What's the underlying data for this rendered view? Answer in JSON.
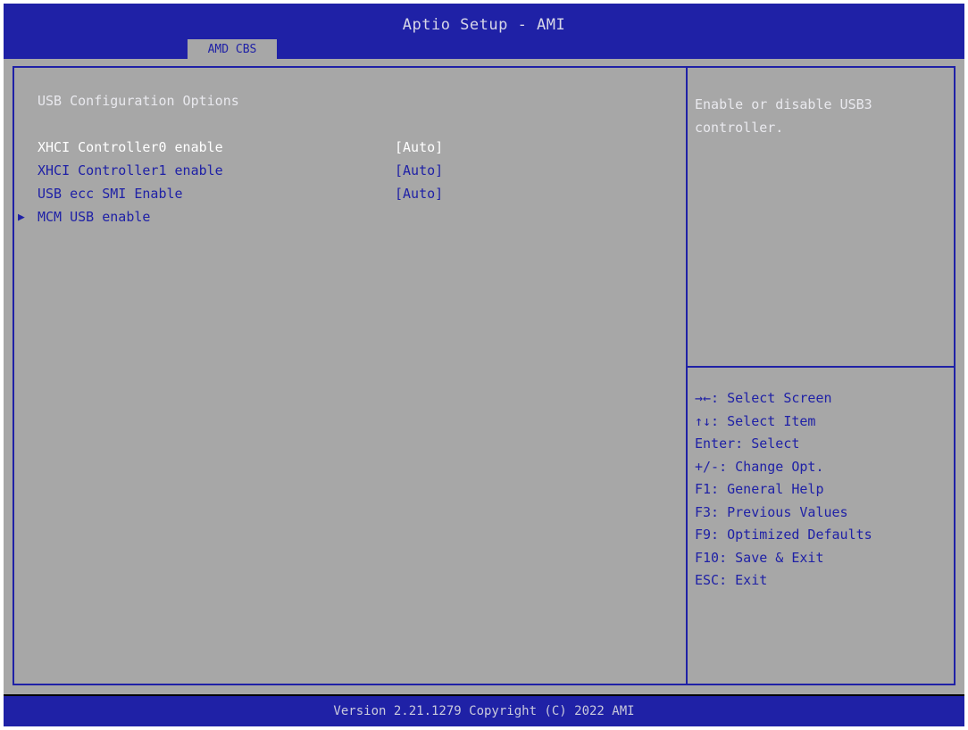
{
  "header": {
    "title": "Aptio Setup - AMI",
    "tab": "AMD CBS"
  },
  "main": {
    "section_title": "USB Configuration Options",
    "items": [
      {
        "label": "XHCI Controller0 enable",
        "value": "[Auto]"
      },
      {
        "label": "XHCI Controller1 enable",
        "value": "[Auto]"
      },
      {
        "label": "USB ecc SMI Enable",
        "value": "[Auto]"
      },
      {
        "label": "MCM USB enable",
        "submenu_arrow": "▶"
      }
    ]
  },
  "help": {
    "description": "Enable or disable USB3 controller."
  },
  "keys": [
    "→←: Select Screen",
    "↑↓: Select Item",
    "Enter: Select",
    "+/-: Change Opt.",
    "F1: General Help",
    "F3: Previous Values",
    "F9: Optimized Defaults",
    "F10: Save & Exit",
    "ESC: Exit"
  ],
  "footer": {
    "version": "Version 2.21.1279 Copyright (C) 2022 AMI"
  },
  "colors": {
    "bios_blue": "#1f21a6",
    "panel_gray": "#a7a7a7",
    "selected_text": "#ffffff"
  }
}
